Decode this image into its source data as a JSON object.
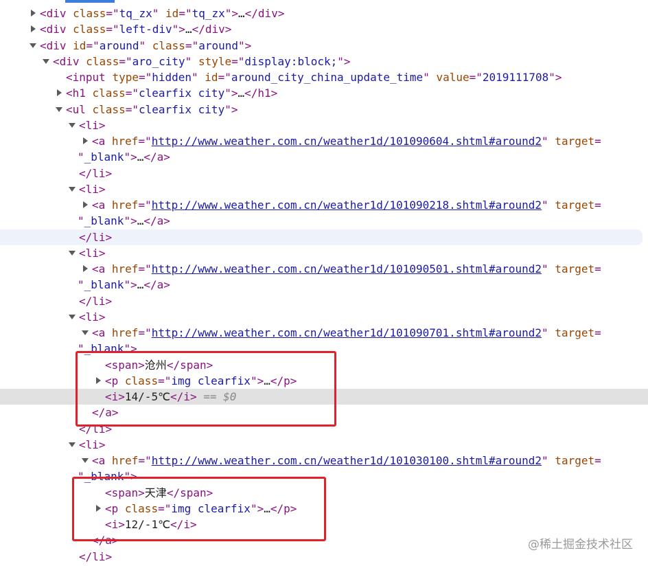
{
  "lines": [
    {
      "depth": 0,
      "toggle": "closed",
      "y": 8,
      "parts": [
        {
          "c": "tg",
          "t": "<div "
        },
        {
          "c": "an",
          "t": "class"
        },
        {
          "c": "tg",
          "t": "=\""
        },
        {
          "c": "av",
          "t": "tq_zx"
        },
        {
          "c": "tg",
          "t": "\" "
        },
        {
          "c": "an",
          "t": "id"
        },
        {
          "c": "tg",
          "t": "=\""
        },
        {
          "c": "av",
          "t": "tq_zx"
        },
        {
          "c": "tg",
          "t": "\">"
        },
        {
          "c": "el",
          "t": "…"
        },
        {
          "c": "tg",
          "t": "</div>"
        }
      ]
    },
    {
      "depth": 0,
      "toggle": "closed",
      "parts": [
        {
          "c": "tg",
          "t": "<div "
        },
        {
          "c": "an",
          "t": "class"
        },
        {
          "c": "tg",
          "t": "=\""
        },
        {
          "c": "av",
          "t": "left-div"
        },
        {
          "c": "tg",
          "t": "\">"
        },
        {
          "c": "el",
          "t": "…"
        },
        {
          "c": "tg",
          "t": "</div>"
        }
      ]
    },
    {
      "depth": 0,
      "toggle": "open",
      "parts": [
        {
          "c": "tg",
          "t": "<div "
        },
        {
          "c": "an",
          "t": "id"
        },
        {
          "c": "tg",
          "t": "=\""
        },
        {
          "c": "av",
          "t": "around"
        },
        {
          "c": "tg",
          "t": "\" "
        },
        {
          "c": "an",
          "t": "class"
        },
        {
          "c": "tg",
          "t": "=\""
        },
        {
          "c": "av",
          "t": "around"
        },
        {
          "c": "tg",
          "t": "\">"
        }
      ]
    },
    {
      "depth": 1,
      "toggle": "open",
      "parts": [
        {
          "c": "tg",
          "t": "<div "
        },
        {
          "c": "an",
          "t": "class"
        },
        {
          "c": "tg",
          "t": "=\""
        },
        {
          "c": "av",
          "t": "aro_city"
        },
        {
          "c": "tg",
          "t": "\" "
        },
        {
          "c": "an",
          "t": "style"
        },
        {
          "c": "tg",
          "t": "=\""
        },
        {
          "c": "av",
          "t": "display:block;"
        },
        {
          "c": "tg",
          "t": "\">"
        }
      ]
    },
    {
      "depth": 2,
      "toggle": "none",
      "parts": [
        {
          "c": "tg",
          "t": "<input "
        },
        {
          "c": "an",
          "t": "type"
        },
        {
          "c": "tg",
          "t": "=\""
        },
        {
          "c": "av",
          "t": "hidden"
        },
        {
          "c": "tg",
          "t": "\" "
        },
        {
          "c": "an",
          "t": "id"
        },
        {
          "c": "tg",
          "t": "=\""
        },
        {
          "c": "av",
          "t": "around_city_china_update_time"
        },
        {
          "c": "tg",
          "t": "\" "
        },
        {
          "c": "an",
          "t": "value"
        },
        {
          "c": "tg",
          "t": "=\""
        },
        {
          "c": "av",
          "t": "2019111708"
        },
        {
          "c": "tg",
          "t": "\">"
        }
      ]
    },
    {
      "depth": 2,
      "toggle": "closed",
      "parts": [
        {
          "c": "tg",
          "t": "<h1 "
        },
        {
          "c": "an",
          "t": "class"
        },
        {
          "c": "tg",
          "t": "=\""
        },
        {
          "c": "av",
          "t": "clearfix city"
        },
        {
          "c": "tg",
          "t": "\">"
        },
        {
          "c": "el",
          "t": "…"
        },
        {
          "c": "tg",
          "t": "</h1>"
        }
      ]
    },
    {
      "depth": 2,
      "toggle": "open",
      "parts": [
        {
          "c": "tg",
          "t": "<ul "
        },
        {
          "c": "an",
          "t": "class"
        },
        {
          "c": "tg",
          "t": "=\""
        },
        {
          "c": "av",
          "t": "clearfix city"
        },
        {
          "c": "tg",
          "t": "\">"
        }
      ]
    },
    {
      "depth": 3,
      "toggle": "open",
      "parts": [
        {
          "c": "tg",
          "t": "<li>"
        }
      ]
    },
    {
      "depth": 4,
      "toggle": "closed",
      "parts": [
        {
          "c": "tg",
          "t": "<a "
        },
        {
          "c": "an",
          "t": "href"
        },
        {
          "c": "tg",
          "t": "=\""
        },
        {
          "c": "lk",
          "t": "http://www.weather.com.cn/weather1d/101090604.shtml#around2"
        },
        {
          "c": "tg",
          "t": "\" "
        },
        {
          "c": "an",
          "t": "target"
        },
        {
          "c": "tg",
          "t": "="
        }
      ]
    },
    {
      "depth": 3,
      "toggle": "none",
      "wrap": true,
      "parts": [
        {
          "c": "tg",
          "t": "\""
        },
        {
          "c": "av",
          "t": "_blank"
        },
        {
          "c": "tg",
          "t": "\">"
        },
        {
          "c": "el",
          "t": "…"
        },
        {
          "c": "tg",
          "t": "</a>"
        }
      ]
    },
    {
      "depth": 3,
      "toggle": "none",
      "parts": [
        {
          "c": "tg",
          "t": "</li>"
        }
      ]
    },
    {
      "depth": 3,
      "toggle": "open",
      "parts": [
        {
          "c": "tg",
          "t": "<li>"
        }
      ]
    },
    {
      "depth": 4,
      "toggle": "closed",
      "parts": [
        {
          "c": "tg",
          "t": "<a "
        },
        {
          "c": "an",
          "t": "href"
        },
        {
          "c": "tg",
          "t": "=\""
        },
        {
          "c": "lk",
          "t": "http://www.weather.com.cn/weather1d/101090218.shtml#around2"
        },
        {
          "c": "tg",
          "t": "\" "
        },
        {
          "c": "an",
          "t": "target"
        },
        {
          "c": "tg",
          "t": "="
        }
      ]
    },
    {
      "depth": 3,
      "toggle": "none",
      "wrap": true,
      "parts": [
        {
          "c": "tg",
          "t": "\""
        },
        {
          "c": "av",
          "t": "_blank"
        },
        {
          "c": "tg",
          "t": "\">"
        },
        {
          "c": "el",
          "t": "…"
        },
        {
          "c": "tg",
          "t": "</a>"
        }
      ]
    },
    {
      "depth": 3,
      "toggle": "none",
      "state": "hover",
      "parts": [
        {
          "c": "tg",
          "t": "</li>"
        }
      ]
    },
    {
      "depth": 3,
      "toggle": "open",
      "parts": [
        {
          "c": "tg",
          "t": "<li>"
        }
      ]
    },
    {
      "depth": 4,
      "toggle": "closed",
      "parts": [
        {
          "c": "tg",
          "t": "<a "
        },
        {
          "c": "an",
          "t": "href"
        },
        {
          "c": "tg",
          "t": "=\""
        },
        {
          "c": "lk",
          "t": "http://www.weather.com.cn/weather1d/101090501.shtml#around2"
        },
        {
          "c": "tg",
          "t": "\" "
        },
        {
          "c": "an",
          "t": "target"
        },
        {
          "c": "tg",
          "t": "="
        }
      ]
    },
    {
      "depth": 3,
      "toggle": "none",
      "wrap": true,
      "parts": [
        {
          "c": "tg",
          "t": "\""
        },
        {
          "c": "av",
          "t": "_blank"
        },
        {
          "c": "tg",
          "t": "\">"
        },
        {
          "c": "el",
          "t": "…"
        },
        {
          "c": "tg",
          "t": "</a>"
        }
      ]
    },
    {
      "depth": 3,
      "toggle": "none",
      "parts": [
        {
          "c": "tg",
          "t": "</li>"
        }
      ]
    },
    {
      "depth": 3,
      "toggle": "open",
      "parts": [
        {
          "c": "tg",
          "t": "<li>"
        }
      ]
    },
    {
      "depth": 4,
      "toggle": "open",
      "parts": [
        {
          "c": "tg",
          "t": "<a "
        },
        {
          "c": "an",
          "t": "href"
        },
        {
          "c": "tg",
          "t": "=\""
        },
        {
          "c": "lk",
          "t": "http://www.weather.com.cn/weather1d/101090701.shtml#around2"
        },
        {
          "c": "tg",
          "t": "\" "
        },
        {
          "c": "an",
          "t": "target"
        },
        {
          "c": "tg",
          "t": "="
        }
      ]
    },
    {
      "depth": 3,
      "toggle": "none",
      "wrap": true,
      "parts": [
        {
          "c": "tg",
          "t": "\""
        },
        {
          "c": "av",
          "t": "_blank"
        },
        {
          "c": "tg",
          "t": "\">"
        }
      ]
    },
    {
      "depth": 5,
      "toggle": "none",
      "parts": [
        {
          "c": "tg",
          "t": "<span>"
        },
        {
          "c": "tx zh",
          "t": "沧州"
        },
        {
          "c": "tg",
          "t": "</span>"
        }
      ]
    },
    {
      "depth": 5,
      "toggle": "closed",
      "parts": [
        {
          "c": "tg",
          "t": "<p "
        },
        {
          "c": "an",
          "t": "class"
        },
        {
          "c": "tg",
          "t": "=\""
        },
        {
          "c": "av",
          "t": "img clearfix"
        },
        {
          "c": "tg",
          "t": "\">"
        },
        {
          "c": "el",
          "t": "…"
        },
        {
          "c": "tg",
          "t": "</p>"
        }
      ]
    },
    {
      "depth": 5,
      "toggle": "none",
      "state": "selected",
      "parts": [
        {
          "c": "tg",
          "t": "<i>"
        },
        {
          "c": "tx",
          "t": "14/-5℃"
        },
        {
          "c": "tg",
          "t": "</i>"
        },
        {
          "c": "dl",
          "t": " == $0"
        }
      ]
    },
    {
      "depth": 4,
      "toggle": "none",
      "parts": [
        {
          "c": "tg",
          "t": "</a>"
        }
      ]
    },
    {
      "depth": 3,
      "toggle": "none",
      "parts": [
        {
          "c": "tg",
          "t": "</li>"
        }
      ]
    },
    {
      "depth": 3,
      "toggle": "open",
      "parts": [
        {
          "c": "tg",
          "t": "<li>"
        }
      ]
    },
    {
      "depth": 4,
      "toggle": "open",
      "parts": [
        {
          "c": "tg",
          "t": "<a "
        },
        {
          "c": "an",
          "t": "href"
        },
        {
          "c": "tg",
          "t": "=\""
        },
        {
          "c": "lk",
          "t": "http://www.weather.com.cn/weather1d/101030100.shtml#around2"
        },
        {
          "c": "tg",
          "t": "\" "
        },
        {
          "c": "an",
          "t": "target"
        },
        {
          "c": "tg",
          "t": "="
        }
      ]
    },
    {
      "depth": 3,
      "toggle": "none",
      "wrap": true,
      "parts": [
        {
          "c": "tg",
          "t": "\""
        },
        {
          "c": "av",
          "t": "_blank"
        },
        {
          "c": "tg",
          "t": "\">"
        }
      ]
    },
    {
      "depth": 5,
      "toggle": "none",
      "parts": [
        {
          "c": "tg",
          "t": "<span>"
        },
        {
          "c": "tx zh",
          "t": "天津"
        },
        {
          "c": "tg",
          "t": "</span>"
        }
      ]
    },
    {
      "depth": 5,
      "toggle": "closed",
      "parts": [
        {
          "c": "tg",
          "t": "<p "
        },
        {
          "c": "an",
          "t": "class"
        },
        {
          "c": "tg",
          "t": "=\""
        },
        {
          "c": "av",
          "t": "img clearfix"
        },
        {
          "c": "tg",
          "t": "\">"
        },
        {
          "c": "el",
          "t": "…"
        },
        {
          "c": "tg",
          "t": "</p>"
        }
      ]
    },
    {
      "depth": 5,
      "toggle": "none",
      "parts": [
        {
          "c": "tg",
          "t": "<i>"
        },
        {
          "c": "tx",
          "t": "12/-1℃"
        },
        {
          "c": "tg",
          "t": "</i>"
        }
      ]
    },
    {
      "depth": 4,
      "toggle": "none",
      "parts": [
        {
          "c": "tg",
          "t": "</a>"
        }
      ]
    },
    {
      "depth": 3,
      "toggle": "none",
      "parts": [
        {
          "c": "tg",
          "t": "</li>"
        }
      ]
    }
  ],
  "watermark": "@稀土掘金技术社区",
  "colors": {
    "tag": "#881280",
    "attr_name": "#994500",
    "attr_value": "#1a1aa6",
    "highlight_box": "#e0202a",
    "selected_row": "#e1e1e1",
    "hover_row": "#eef3fb"
  }
}
